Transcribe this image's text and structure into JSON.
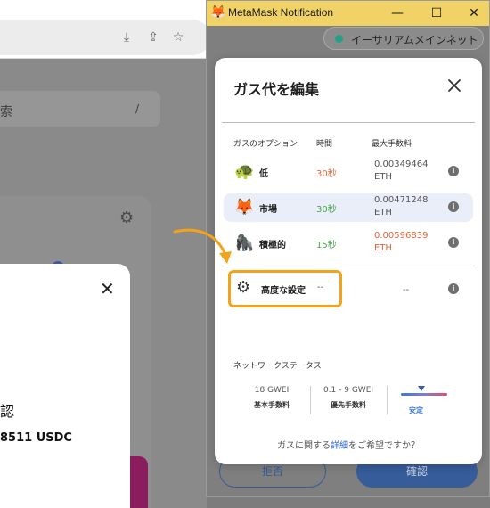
{
  "background": {
    "search_text": "索",
    "search_slash": "/",
    "modal_close": "✕",
    "confirm_text": "認",
    "amount_text": "8511 USDC"
  },
  "window": {
    "title": "MetaMask Notification",
    "network_label": "イーサリアムメインネット",
    "reject_label": "拒否",
    "confirm_label": "確認"
  },
  "gas": {
    "title": "ガス代を編集",
    "headers": {
      "option": "ガスのオプション",
      "time": "時間",
      "max_fee": "最大手数料"
    },
    "options": [
      {
        "icon": "🐢",
        "name": "低",
        "time": "30秒",
        "time_color": "#e0683a",
        "fee_line1": "0.00349464",
        "fee_line2": "ETH",
        "fee_color": "#555555"
      },
      {
        "icon": "🦊",
        "name": "市場",
        "time": "30秒",
        "time_color": "#4aa64a",
        "fee_line1": "0.00471248",
        "fee_line2": "ETH",
        "fee_color": "#555555"
      },
      {
        "icon": "🦍",
        "name": "積極的",
        "time": "15秒",
        "time_color": "#4aa64a",
        "fee_line1": "0.00596839",
        "fee_line2": "ETH",
        "fee_color": "#e0683a"
      }
    ],
    "advanced": {
      "name": "高度な設定",
      "time": "--",
      "fee": "--"
    },
    "info_glyph": "i",
    "network_status_label": "ネットワークステータス",
    "network": [
      {
        "value": "18 GWEI",
        "sub": "基本手数料"
      },
      {
        "value": "0.1 - 9 GWEI",
        "sub": "優先手数料"
      },
      {
        "value": "",
        "sub": "安定"
      }
    ],
    "help_before": "ガスに関する",
    "help_link": "詳細",
    "help_after": "をご希望ですか？"
  }
}
